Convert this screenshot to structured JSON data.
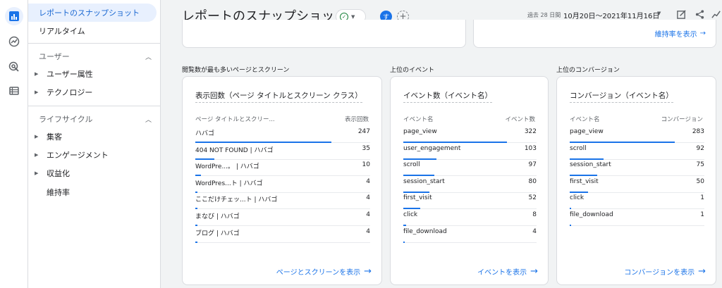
{
  "rail": {
    "icons": [
      "reports-icon",
      "explore-icon",
      "advertising-icon",
      "configure-icon"
    ]
  },
  "sidebar": {
    "snapshot": "レポートのスナップショット",
    "realtime": "リアルタイム",
    "user_section": {
      "title": "ユーザー",
      "items": [
        "ユーザー属性",
        "テクノロジー"
      ]
    },
    "lifecycle_section": {
      "title": "ライフサイクル",
      "items": [
        "集客",
        "エンゲージメント",
        "収益化",
        "維持率"
      ]
    }
  },
  "header": {
    "title": "レポートのスナップショット",
    "avatar_letter": "す",
    "add_compare": "+",
    "date_prefix": "過去 28 日間",
    "date_range": "10月20日～2021年11月16日"
  },
  "prev_card": {
    "link": "維持率を表示"
  },
  "sections": {
    "pages": "閲覧数が最も多いページとスクリーン",
    "events": "上位のイベント",
    "conversions": "上位のコンバージョン"
  },
  "pages_card": {
    "title": "表示回数（ページ タイトルとスクリーン クラス）",
    "col1": "ページ タイトルとスクリー...",
    "col2": "表示回数",
    "link": "ページとスクリーンを表示",
    "rows": [
      {
        "name": "ハバゴ",
        "value": "247",
        "ratio": 1.0
      },
      {
        "name": "404 NOT FOUND | ハバゴ",
        "value": "35",
        "ratio": 0.142
      },
      {
        "name": "WordPre...。 | ハバゴ",
        "value": "10",
        "ratio": 0.04
      },
      {
        "name": "WordPres...ト | ハバゴ",
        "value": "4",
        "ratio": 0.016
      },
      {
        "name": "ここだけチェッ...ト | ハバゴ",
        "value": "4",
        "ratio": 0.016
      },
      {
        "name": "まなび | ハバゴ",
        "value": "4",
        "ratio": 0.016
      },
      {
        "name": "ブログ | ハバゴ",
        "value": "4",
        "ratio": 0.016
      }
    ]
  },
  "events_card": {
    "title": "イベント数（イベント名）",
    "col1": "イベント名",
    "col2": "イベント数",
    "link": "イベントを表示",
    "rows": [
      {
        "name": "page_view",
        "value": "322",
        "ratio": 1.0
      },
      {
        "name": "user_engagement",
        "value": "103",
        "ratio": 0.32
      },
      {
        "name": "scroll",
        "value": "97",
        "ratio": 0.301
      },
      {
        "name": "session_start",
        "value": "80",
        "ratio": 0.248
      },
      {
        "name": "first_visit",
        "value": "52",
        "ratio": 0.161
      },
      {
        "name": "click",
        "value": "8",
        "ratio": 0.025
      },
      {
        "name": "file_download",
        "value": "4",
        "ratio": 0.012
      }
    ]
  },
  "conversions_card": {
    "title": "コンバージョン（イベント名）",
    "col1": "イベント名",
    "col2": "コンバージョン",
    "link": "コンバージョンを表示",
    "rows": [
      {
        "name": "page_view",
        "value": "283",
        "ratio": 1.0
      },
      {
        "name": "scroll",
        "value": "92",
        "ratio": 0.325
      },
      {
        "name": "session_start",
        "value": "75",
        "ratio": 0.265
      },
      {
        "name": "first_visit",
        "value": "50",
        "ratio": 0.177
      },
      {
        "name": "click",
        "value": "1",
        "ratio": 0.004
      },
      {
        "name": "file_download",
        "value": "1",
        "ratio": 0.004
      }
    ]
  },
  "colors": {
    "accent": "#1a73e8",
    "active_bg": "#e8f0fe",
    "check": "#188038"
  }
}
